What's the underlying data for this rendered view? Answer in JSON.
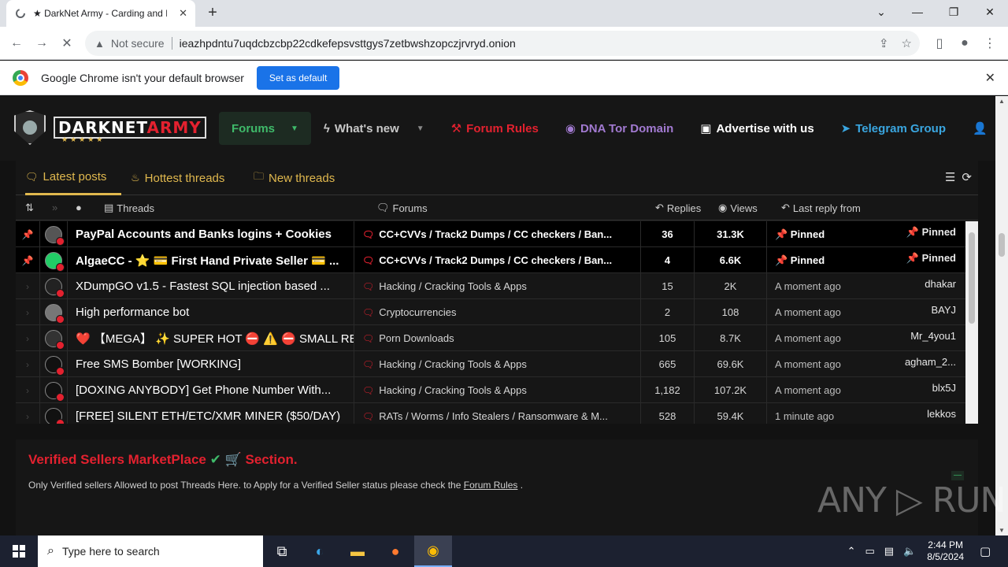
{
  "browser": {
    "tab_title": "★ DarkNet Army - Carding and I",
    "new_tab": "+",
    "not_secure": "Not secure",
    "url": "ieazhpdntu7uqdcbzcbp22cdkefepsvsttgys7zetbwshzopczjrvryd.onion",
    "infobar_msg": "Google Chrome isn't your default browser",
    "set_default": "Set as default"
  },
  "site": {
    "brand_dark": "DARKNET",
    "brand_army": "ARMY",
    "nav": {
      "forums": "Forums",
      "whats_new": "What's new",
      "rules": "Forum Rules",
      "dna": "DNA Tor Domain",
      "advertise": "Advertise with us",
      "telegram": "Telegram Group"
    },
    "tabs": {
      "latest": "Latest posts",
      "hottest": "Hottest threads",
      "new": "New threads"
    },
    "columns": {
      "threads": "Threads",
      "forums": "Forums",
      "replies": "Replies",
      "views": "Views",
      "last_reply": "Last reply from"
    },
    "rows": [
      {
        "title": "PayPal Accounts and Banks logins + Cookies",
        "forum": "CC+CVVs / Track2 Dumps / CC checkers / Ban...",
        "replies": "36",
        "views": "31.3K",
        "time": "📌 Pinned",
        "user": "📌 Pinned",
        "pinned": true
      },
      {
        "title": "AlgaeCC - ⭐ 💳 First Hand Private Seller 💳 ...",
        "forum": "CC+CVVs / Track2 Dumps / CC checkers / Ban...",
        "replies": "4",
        "views": "6.6K",
        "time": "📌 Pinned",
        "user": "📌 Pinned",
        "pinned": true
      },
      {
        "title": "XDumpGO v1.5 - Fastest SQL injection based ...",
        "forum": "Hacking / Cracking Tools & Apps",
        "replies": "15",
        "views": "2K",
        "time": "A moment ago",
        "user": "dhakar",
        "pinned": false
      },
      {
        "title": "High performance bot",
        "forum": "Cryptocurrencies",
        "replies": "2",
        "views": "108",
        "time": "A moment ago",
        "user": "BAYJ",
        "pinned": false
      },
      {
        "title": "❤️ 【MEGA】 ✨ SUPER HOT ⛔ ⚠️ ⛔ SMALL RE...",
        "forum": "Porn Downloads",
        "replies": "105",
        "views": "8.7K",
        "time": "A moment ago",
        "user": "Mr_4you1",
        "pinned": false
      },
      {
        "title": "Free SMS Bomber [WORKING]",
        "forum": "Hacking / Cracking Tools & Apps",
        "replies": "665",
        "views": "69.6K",
        "time": "A moment ago",
        "user": "agham_2...",
        "pinned": false
      },
      {
        "title": "[DOXING ANYBODY] Get Phone Number With...",
        "forum": "Hacking / Cracking Tools & Apps",
        "replies": "1,182",
        "views": "107.2K",
        "time": "A moment ago",
        "user": "blx5J",
        "pinned": false
      },
      {
        "title": "[FREE] SILENT ETH/ETC/XMR MINER ($50/DAY)",
        "forum": "RATs / Worms / Info Stealers / Ransomware & M...",
        "replies": "528",
        "views": "59.4K",
        "time": "1 minute ago",
        "user": "lekkos",
        "pinned": false
      }
    ],
    "verified": {
      "title": "Verified Sellers MarketPlace",
      "section": "Section.",
      "desc": "Only Verified sellers Allowed to post Threads Here. to Apply for a Verified Seller status please check the",
      "link": "Forum Rules",
      "dot": " ."
    }
  },
  "watermark": "ANY ▷ RUN",
  "taskbar": {
    "search_placeholder": "Type here to search",
    "time": "2:44 PM",
    "date": "8/5/2024"
  }
}
